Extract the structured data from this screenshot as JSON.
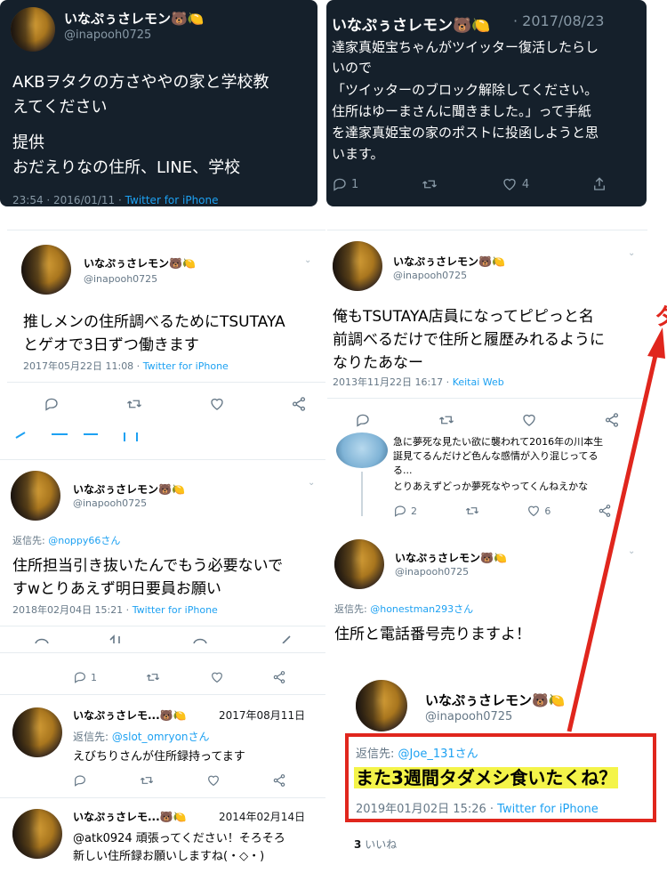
{
  "tweets": [
    {
      "name": "いなぷぅさレモン🐻🍋",
      "handle": "@inapooh0725",
      "lines": [
        "AKBヲタクの方さややの家と学校教",
        "えてください",
        "提供",
        "おだえりなの住所、LINE、学校"
      ],
      "time": "23:54 · 2016/01/11 ·",
      "source": "Twitter for iPhone"
    },
    {
      "name": "いなぷぅさレモン🐻🍋",
      "date": "· 2017/08/23",
      "lines": [
        "達家真姫宝ちゃんがツイッター復活したらし",
        "いので",
        "「ツイッターのブロック解除してください。",
        "住所はゆーまさんに聞きました。」って手紙",
        "を達家真姫宝の家のポストに投函しようと思",
        "います。"
      ],
      "reply_count": "1",
      "like_count": "4"
    },
    {
      "name": "いなぷぅさレモン🐻🍋",
      "handle": "@inapooh0725",
      "lines": [
        "推しメンの住所調べるためにTSUTAYA",
        "とゲオで3日ずつ働きます"
      ],
      "time": "2017年05月22日 11:08 ·",
      "source": "Twitter for iPhone"
    },
    {
      "name": "いなぷぅさレモン🐻🍋",
      "handle": "@inapooh0725",
      "lines": [
        "俺もTSUTAYA店員になってピピっと名",
        "前調べるだけで住所と履歴みれるように",
        "なりたあなー"
      ],
      "time": "2013年11月22日 16:17 ·",
      "source": "Keitai Web"
    },
    {
      "lines": [
        "急に夢死な見たい欲に襲われて2016年の川本生",
        "誕見てるんだけど色んな感情が入り混じってる",
        "る...",
        "とりあえずどっか夢死なやってくんねえかな"
      ],
      "reply_count": "2",
      "like_count": "6"
    },
    {
      "name": "いなぷぅさレモン🐻🍋",
      "handle": "@inapooh0725",
      "reply_label": "返信先:",
      "reply_to": "@noppy66さん",
      "lines": [
        "住所担当引き抜いたんでもう必要ないで",
        "すwとりあえず明日要員お願い"
      ],
      "time": "2018年02月04日 15:21 ·",
      "source": "Twitter for iPhone",
      "reply_count": "1"
    },
    {
      "name": "いなぷぅさレモン🐻🍋",
      "handle": "@inapooh0725",
      "reply_label": "返信先:",
      "reply_to": "@honestman293さん",
      "lines": [
        "住所と電話番号売りますよ！"
      ]
    },
    {
      "name": "いなぷぅさレモ...🐻🍋",
      "date": "2017年08月11日",
      "reply_label": "返信先:",
      "reply_to": "@slot_omryonさん",
      "lines": [
        "えびちりさんが住所録持ってます"
      ]
    },
    {
      "name": "いなぷぅさレモン🐻🍋",
      "handle": "@inapooh0725",
      "reply_label": "返信先:",
      "reply_to": "@Joe_131さん",
      "lines": [
        "また3週間タダメシ食いたくね？"
      ],
      "time": "2019年01月02日 15:26 ·",
      "source": "Twitter for iPhone",
      "likes_num": "3",
      "likes_label": "いいね"
    },
    {
      "name": "いなぷぅさレモ...🐻🍋",
      "date": "2014年02月14日",
      "lines": [
        "@atk0924 頑張ってください！そろそろ",
        "新しい住所録お願いしますね(・◇・)"
      ]
    }
  ],
  "side_char": "タ",
  "colors": {
    "dark_bg": "#15202b",
    "link": "#1da1f2",
    "highlight_box": "#e0261d",
    "marker": "#f4f449"
  }
}
